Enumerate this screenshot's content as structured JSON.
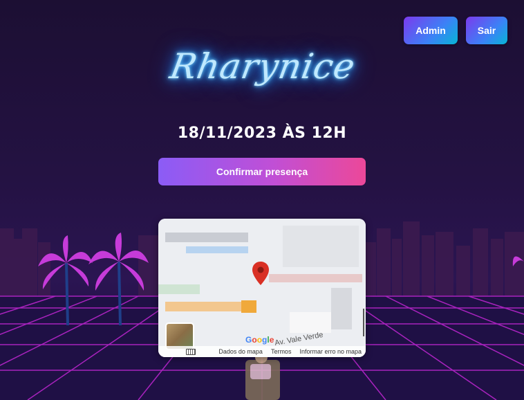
{
  "header": {
    "admin_label": "Admin",
    "logout_label": "Sair"
  },
  "logo": {
    "text": "Rharynice"
  },
  "event": {
    "date_label": "18/11/2023 ÀS 12H",
    "confirm_label": "Confirmar presença"
  },
  "map": {
    "street_label": "Av. Vale Verde",
    "google_letters": [
      "G",
      "o",
      "o",
      "g",
      "l",
      "e"
    ],
    "footer": {
      "map_data": "Dados do mapa",
      "terms": "Termos",
      "report": "Informar erro no mapa"
    },
    "icons": {
      "pin": "map-pin-icon",
      "keyboard": "keyboard-icon"
    }
  },
  "colors": {
    "accent_blue": "#3b82f6",
    "accent_purple": "#8b5cf6",
    "accent_pink": "#ec4899",
    "neon_grid": "#c026d3",
    "neon_logo": "#3ab4ff"
  }
}
